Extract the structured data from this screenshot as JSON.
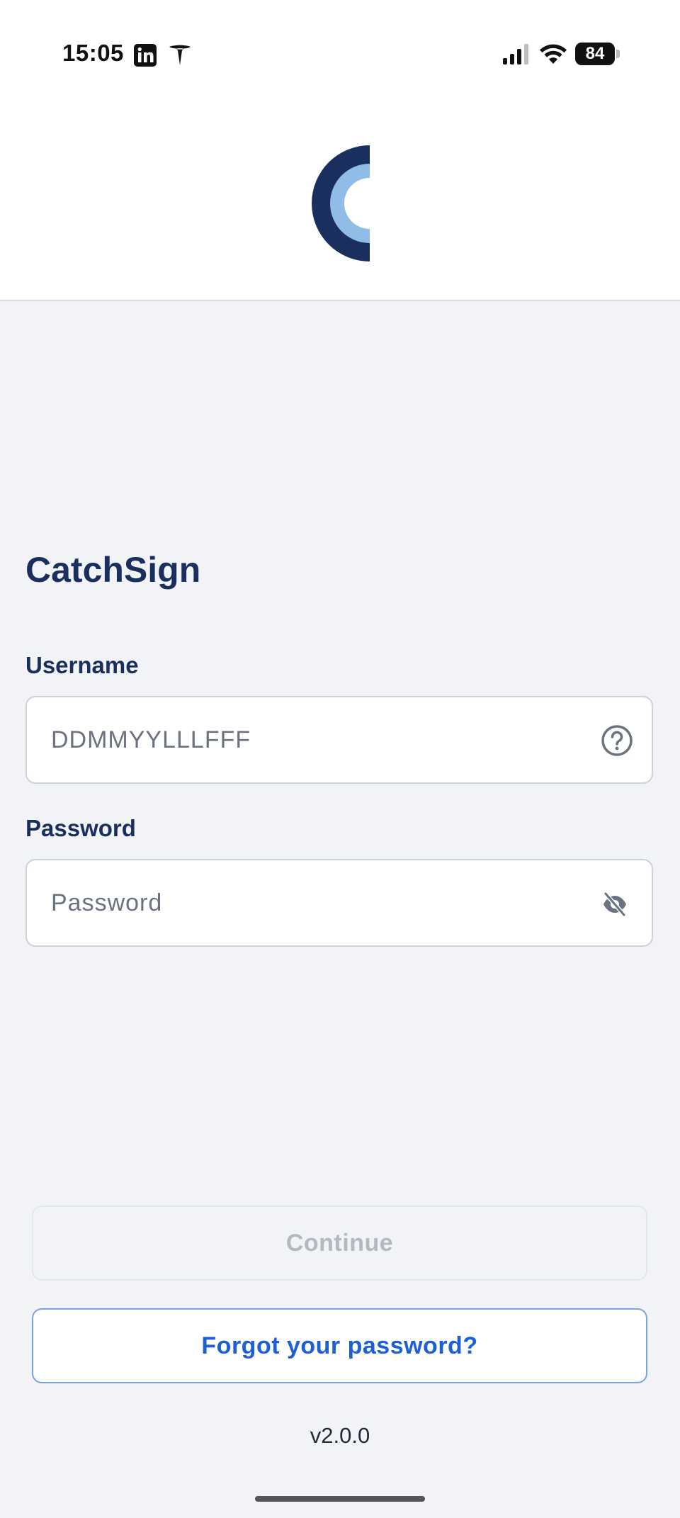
{
  "status_bar": {
    "time": "15:05",
    "battery_level": "84",
    "icons": [
      "linkedin-icon",
      "tesla-icon",
      "signal-icon",
      "wifi-icon",
      "battery-icon"
    ]
  },
  "header": {
    "logo": "catchsign-logo"
  },
  "main": {
    "title": "CatchSign",
    "username": {
      "label": "Username",
      "placeholder": "DDMMYYLLLFFF",
      "value": "",
      "help_icon": "help-circle-icon"
    },
    "password": {
      "label": "Password",
      "placeholder": "Password",
      "value": "",
      "toggle_icon": "eye-off-icon"
    }
  },
  "actions": {
    "continue_label": "Continue",
    "forgot_label": "Forgot your password?"
  },
  "footer": {
    "version": "v2.0.0"
  },
  "colors": {
    "brand_dark": "#1b2f5e",
    "brand_light": "#8fbde8",
    "link": "#1d5fd6",
    "background": "#f1f3f7"
  }
}
